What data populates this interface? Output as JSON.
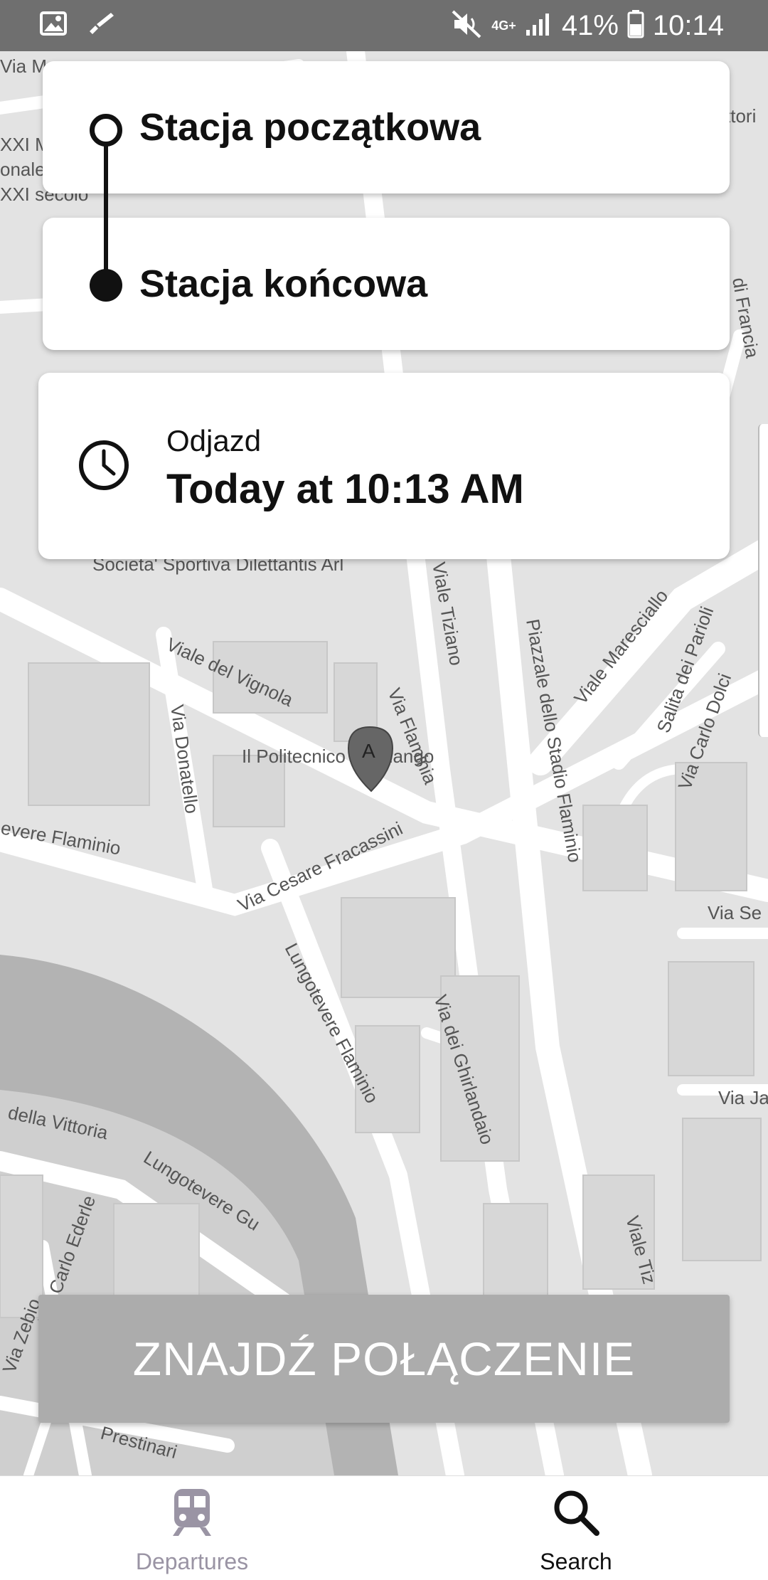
{
  "status_bar": {
    "left_icons": [
      "image-icon",
      "brush-check-icon"
    ],
    "network": "4G+",
    "battery": "41%",
    "time": "10:14"
  },
  "map": {
    "labels": [
      "Via Flaminia",
      "Viale Tiziano",
      "Viale del Vignola",
      "Via Donatello",
      "Il Politecnico Fandango",
      "Via Cesare Fracassini",
      "Lungotevere Flaminio",
      "Viale Maresciallo",
      "Salita dei Parioli",
      "Via Carlo Dolci",
      "Societa' Sportiva Dilettantis Arl",
      "Piazzale dello Stadio Flaminio",
      "Via dei Ghirlandaio",
      "Lungotevere Gu",
      "della Vittoria",
      "Via Carlo Ederle",
      "Via Zebio",
      "Prestinari",
      "evere Flaminio",
      "Via Se",
      "Via Ja",
      "Viale Tiz",
      "di Francia",
      "XXI M",
      "onale",
      "XXI secolo",
      "Via M",
      "ttori"
    ],
    "marker_label": "A"
  },
  "route": {
    "start_placeholder": "Stacja początkowa",
    "end_placeholder": "Stacja końcowa"
  },
  "time": {
    "caption": "Odjazd",
    "value": "Today at 10:13 AM"
  },
  "find_button": "ZNAJDŹ POŁĄCZENIE",
  "nav": {
    "departures": "Departures",
    "search": "Search"
  },
  "colors": {
    "status_bar": "#6f6f6f",
    "button": "#acacac",
    "nav_inactive": "#9a94a4",
    "nav_active": "#111111"
  }
}
